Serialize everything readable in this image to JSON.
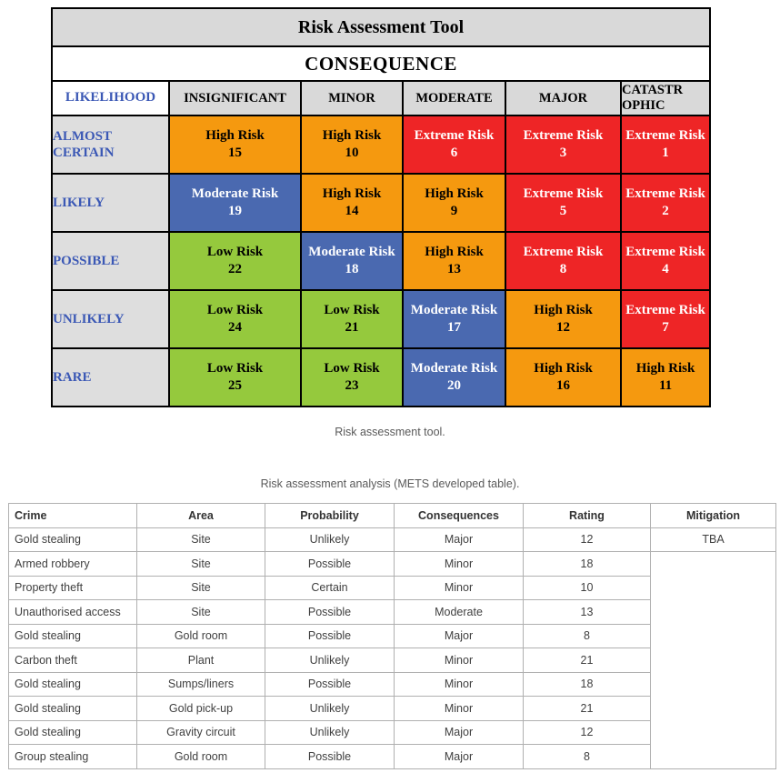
{
  "matrix": {
    "title": "Risk Assessment Tool",
    "consequence_label": "CONSEQUENCE",
    "likelihood_label": "LIKELIHOOD",
    "consequence_headers": [
      "INSIGNIFICANT",
      "MINOR",
      "MODERATE",
      "MAJOR",
      "CATASTR\nOPHIC"
    ],
    "likelihood_rows": [
      "ALMOST\nCERTAIN",
      "LIKELY",
      "POSSIBLE",
      "UNLIKELY",
      "RARE"
    ],
    "colors": {
      "low": "#95c93d",
      "moderate": "#4a69b0",
      "high": "#f5990f",
      "extreme": "#ee2526",
      "header_gray": "#d9d9d9",
      "likelihood_text": "#3b58b5"
    },
    "cells": [
      [
        {
          "label": "High Risk",
          "value": "15",
          "severity": "high"
        },
        {
          "label": "High Risk",
          "value": "10",
          "severity": "high"
        },
        {
          "label": "Extreme Risk",
          "value": "6",
          "severity": "extreme"
        },
        {
          "label": "Extreme Risk",
          "value": "3",
          "severity": "extreme"
        },
        {
          "label": "Extreme Risk",
          "value": "1",
          "severity": "extreme"
        }
      ],
      [
        {
          "label": "Moderate Risk",
          "value": "19",
          "severity": "moderate"
        },
        {
          "label": "High Risk",
          "value": "14",
          "severity": "high"
        },
        {
          "label": "High Risk",
          "value": "9",
          "severity": "high"
        },
        {
          "label": "Extreme Risk",
          "value": "5",
          "severity": "extreme"
        },
        {
          "label": "Extreme Risk",
          "value": "2",
          "severity": "extreme"
        }
      ],
      [
        {
          "label": "Low Risk",
          "value": "22",
          "severity": "low"
        },
        {
          "label": "Moderate Risk",
          "value": "18",
          "severity": "moderate"
        },
        {
          "label": "High Risk",
          "value": "13",
          "severity": "high"
        },
        {
          "label": "Extreme Risk",
          "value": "8",
          "severity": "extreme"
        },
        {
          "label": "Extreme Risk",
          "value": "4",
          "severity": "extreme"
        }
      ],
      [
        {
          "label": "Low Risk",
          "value": "24",
          "severity": "low"
        },
        {
          "label": "Low Risk",
          "value": "21",
          "severity": "low"
        },
        {
          "label": "Moderate Risk",
          "value": "17",
          "severity": "moderate"
        },
        {
          "label": "High Risk",
          "value": "12",
          "severity": "high"
        },
        {
          "label": "Extreme Risk",
          "value": "7",
          "severity": "extreme"
        }
      ],
      [
        {
          "label": "Low Risk",
          "value": "25",
          "severity": "low"
        },
        {
          "label": "Low Risk",
          "value": "23",
          "severity": "low"
        },
        {
          "label": "Moderate Risk",
          "value": "20",
          "severity": "moderate"
        },
        {
          "label": "High Risk",
          "value": "16",
          "severity": "high"
        },
        {
          "label": "High Risk",
          "value": "11",
          "severity": "high"
        }
      ]
    ]
  },
  "captions": {
    "matrix": "Risk assessment tool.",
    "analysis": "Risk assessment analysis (METS developed table)."
  },
  "analysis": {
    "headers": [
      "Crime",
      "Area",
      "Probability",
      "Consequences",
      "Rating",
      "Mitigation"
    ],
    "mitigation_first": "TBA",
    "rows": [
      {
        "crime": "Gold stealing",
        "area": "Site",
        "probability": "Unlikely",
        "consequences": "Major",
        "rating": "12"
      },
      {
        "crime": "Armed robbery",
        "area": "Site",
        "probability": "Possible",
        "consequences": "Minor",
        "rating": "18"
      },
      {
        "crime": "Property theft",
        "area": "Site",
        "probability": "Certain",
        "consequences": "Minor",
        "rating": "10"
      },
      {
        "crime": "Unauthorised access",
        "area": "Site",
        "probability": "Possible",
        "consequences": "Moderate",
        "rating": "13"
      },
      {
        "crime": "Gold stealing",
        "area": "Gold room",
        "probability": "Possible",
        "consequences": "Major",
        "rating": "8"
      },
      {
        "crime": "Carbon theft",
        "area": "Plant",
        "probability": "Unlikely",
        "consequences": "Minor",
        "rating": "21"
      },
      {
        "crime": "Gold stealing",
        "area": "Sumps/liners",
        "probability": "Possible",
        "consequences": "Minor",
        "rating": "18"
      },
      {
        "crime": "Gold stealing",
        "area": "Gold pick-up",
        "probability": "Unlikely",
        "consequences": "Minor",
        "rating": "21"
      },
      {
        "crime": "Gold stealing",
        "area": "Gravity circuit",
        "probability": "Unlikely",
        "consequences": "Major",
        "rating": "12"
      },
      {
        "crime": "Group stealing",
        "area": "Gold room",
        "probability": "Possible",
        "consequences": "Major",
        "rating": "8"
      }
    ]
  }
}
